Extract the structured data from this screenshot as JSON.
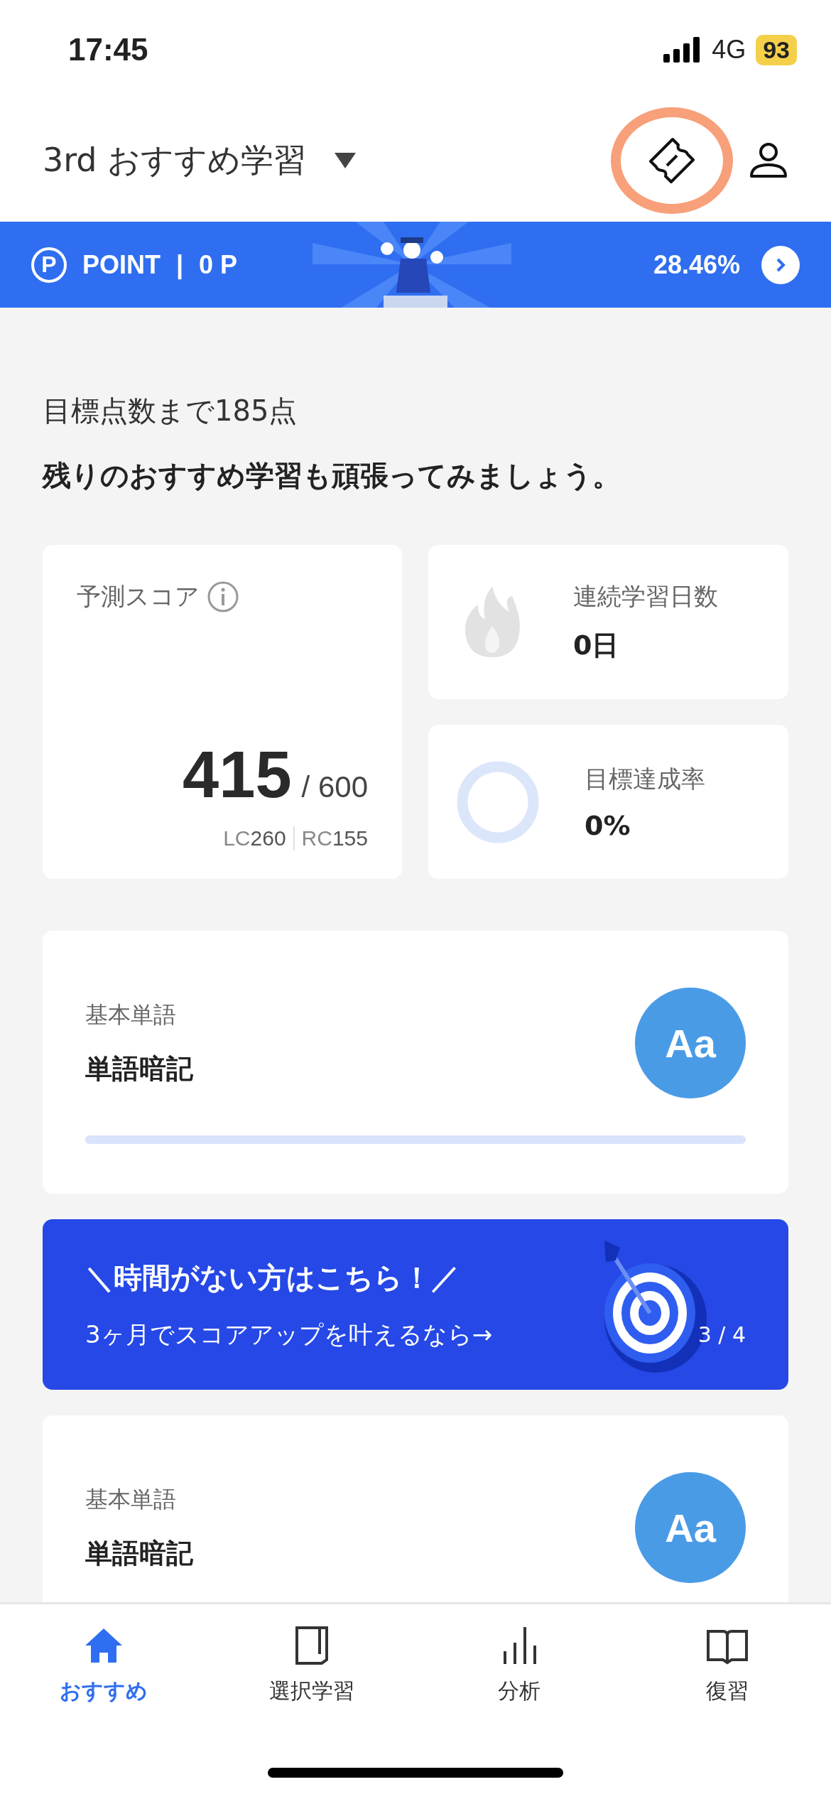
{
  "status_bar": {
    "time": "17:45",
    "network": "4G",
    "battery": "93"
  },
  "header": {
    "title": "3rd おすすめ学習"
  },
  "point_bar": {
    "icon_letter": "P",
    "label": "POINT",
    "separator": "|",
    "points": "0 P",
    "rate": "28.46%"
  },
  "goal": {
    "remaining": "目標点数まで185点",
    "message": "残りのおすすめ学習も頑張ってみましょう。"
  },
  "score_card": {
    "label": "予測スコア",
    "score": "415",
    "total": "/ 600",
    "lc_label": "LC",
    "lc": "260",
    "rc_label": "RC",
    "rc": "155"
  },
  "stat_cards": [
    {
      "kind": "streak",
      "label": "連続学習日数",
      "value": "0日"
    },
    {
      "kind": "goal",
      "label": "目標達成率",
      "value": "0%"
    }
  ],
  "study_cards": [
    {
      "kind": "words",
      "category": "基本単語",
      "title": "単語暗記",
      "badge": "Aa",
      "show_progress": true
    },
    {
      "kind": "promo",
      "headline": "＼時間がない方はこちら！／",
      "subtext": "3ヶ月でスコアアップを叶えるなら→",
      "pager": "3 / 4"
    },
    {
      "kind": "words",
      "category": "基本単語",
      "title": "単語暗記",
      "badge": "Aa",
      "show_progress": false
    }
  ],
  "tabs": [
    {
      "label": "おすすめ",
      "kind": "home",
      "selected": true
    },
    {
      "label": "選択学習",
      "kind": "note",
      "selected": false
    },
    {
      "label": "分析",
      "kind": "bars",
      "selected": false
    },
    {
      "label": "復習",
      "kind": "book",
      "selected": false
    }
  ]
}
